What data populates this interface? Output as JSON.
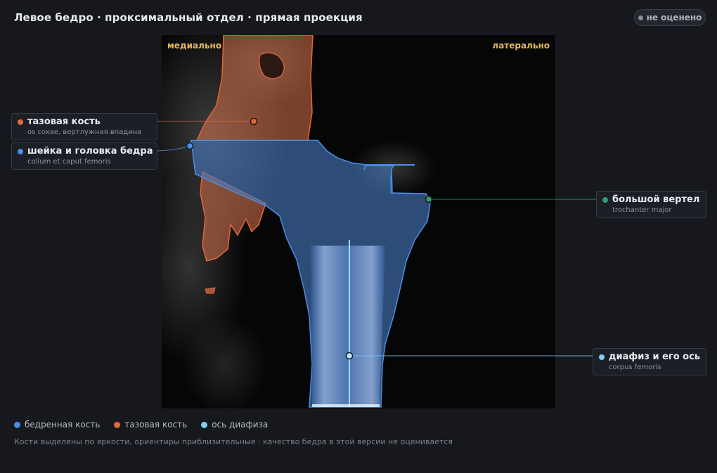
{
  "header": {
    "title": "Левое бедро · проксимальный отдел · прямая проекция",
    "status_badge": "не оценено"
  },
  "image": {
    "orient_left": "медиально",
    "orient_right": "латерально"
  },
  "annotations": [
    {
      "key": "pelvis",
      "title": "тазовая кость",
      "subtitle": "os coxae, вертлужная впадина",
      "color": "#e0673c"
    },
    {
      "key": "neck",
      "title": "шейка и головка бедра",
      "subtitle": "collum et caput femoris",
      "color": "#4a8fe8"
    },
    {
      "key": "trochanter",
      "title": "большой вертел",
      "subtitle": "trochanter major",
      "color": "#2f9d73"
    },
    {
      "key": "shaft",
      "title": "диафиз и его ось",
      "subtitle": "corpus femoris",
      "color": "#7fd0f5"
    }
  ],
  "legend": [
    {
      "label": "бедренная кость",
      "color": "#4a8fe8"
    },
    {
      "label": "тазовая кость",
      "color": "#e0673c"
    },
    {
      "label": "ось диафиза",
      "color": "#7fd0f5"
    }
  ],
  "footer": {
    "note": "Кости выделены по яркости, ориентиры приблизительные · качество бедра в этой версии не оценивается"
  }
}
